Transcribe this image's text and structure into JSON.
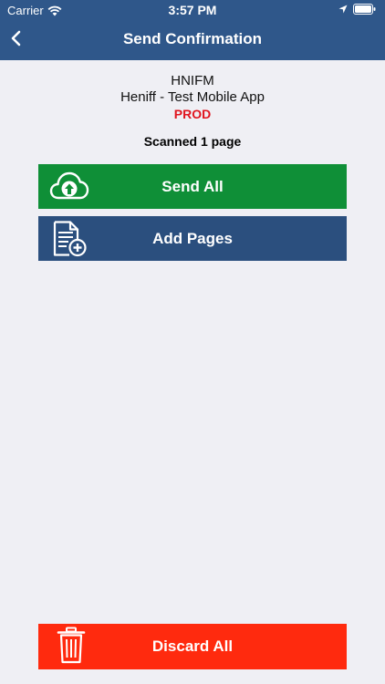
{
  "status_bar": {
    "carrier": "Carrier",
    "time": "3:57 PM",
    "icons": [
      "wifi-icon",
      "location-arrow-icon",
      "battery-icon"
    ]
  },
  "nav": {
    "title": "Send Confirmation",
    "back_icon": "chevron-left-icon"
  },
  "info": {
    "code": "HNIFM",
    "name": "Heniff - Test Mobile App",
    "environment": "PROD"
  },
  "scan_status": "Scanned 1 page",
  "actions": {
    "send_all": {
      "label": "Send All",
      "icon": "cloud-upload-icon",
      "color": "#0f8f37"
    },
    "add_pages": {
      "label": "Add Pages",
      "icon": "add-document-icon",
      "color": "#2b4f7e"
    },
    "discard_all": {
      "label": "Discard All",
      "icon": "trash-icon",
      "color": "#ff2a0e"
    }
  },
  "colors": {
    "header": "#2f578a",
    "background": "#efeff4",
    "environment_text": "#e0141e"
  }
}
